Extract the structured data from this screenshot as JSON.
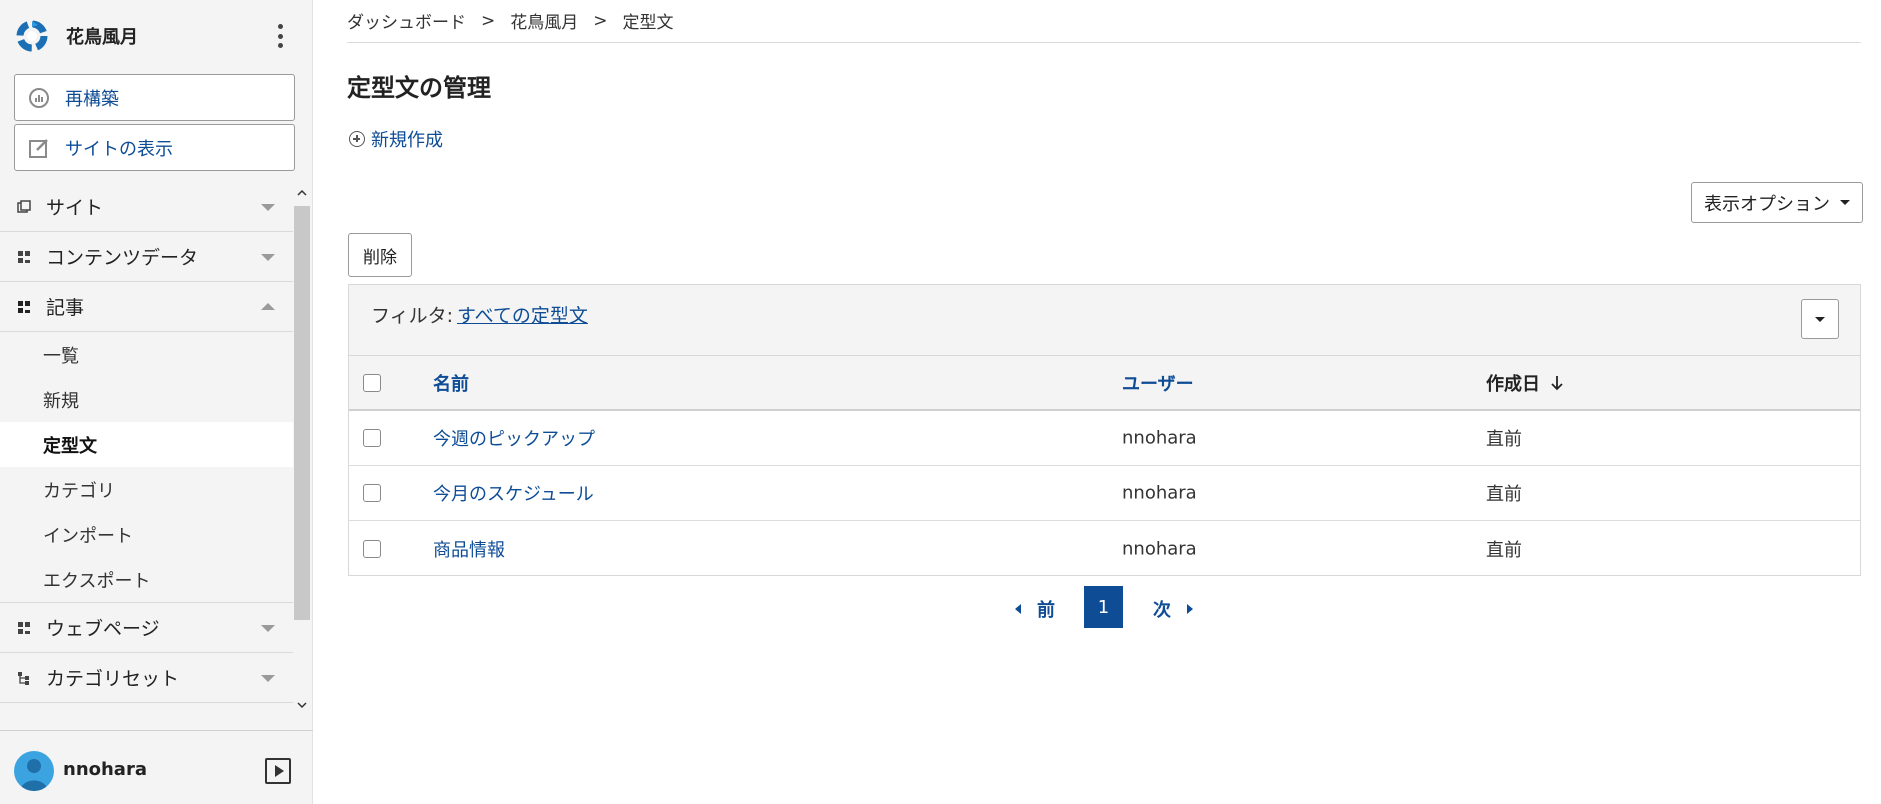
{
  "sidebar": {
    "site_name": "花鳥風月",
    "rebuild_label": "再構築",
    "view_site_label": "サイトの表示",
    "sections": {
      "site": "サイト",
      "content_data": "コンテンツデータ",
      "entries": "記事",
      "webpages": "ウェブページ",
      "category_sets": "カテゴリセット"
    },
    "entries_items": [
      "一覧",
      "新規",
      "定型文",
      "カテゴリ",
      "インポート",
      "エクスポート"
    ],
    "active_item": "定型文",
    "user": "nnohara"
  },
  "breadcrumb": [
    "ダッシュボード",
    "花鳥風月",
    "定型文"
  ],
  "breadcrumb_separator": ">",
  "page_title": "定型文の管理",
  "new_link": "新規作成",
  "display_options": "表示オプション",
  "delete_button": "削除",
  "filter": {
    "label": "フィルタ:",
    "value": "すべての定型文"
  },
  "table": {
    "headers": {
      "name": "名前",
      "user": "ユーザー",
      "created": "作成日"
    },
    "rows": [
      {
        "name": "今週のピックアップ",
        "user": "nnohara",
        "created": "直前"
      },
      {
        "name": "今月のスケジュール",
        "user": "nnohara",
        "created": "直前"
      },
      {
        "name": "商品情報",
        "user": "nnohara",
        "created": "直前"
      }
    ]
  },
  "pagination": {
    "prev": "前",
    "current": "1",
    "next": "次"
  },
  "colors": {
    "link": "#0e4c96",
    "sidebar_bg": "#f4f4f4",
    "active_page": "#0e4c96"
  }
}
